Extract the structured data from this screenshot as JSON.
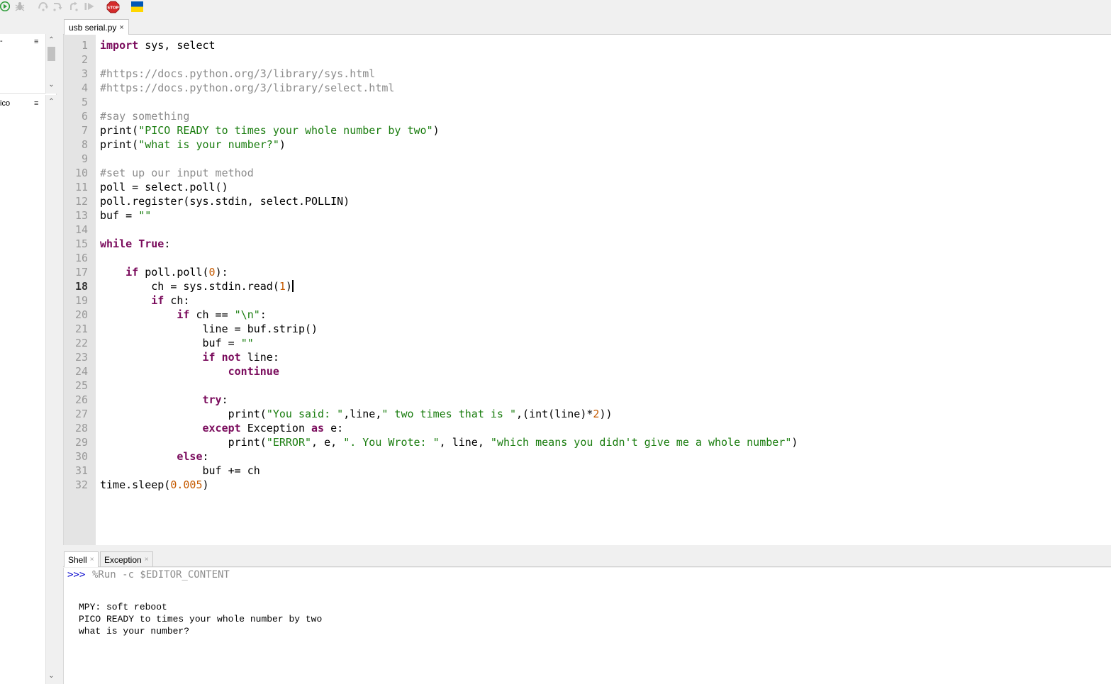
{
  "toolbar": {
    "stop_label": "STOP",
    "icons": [
      "run-icon",
      "debug-icon",
      "step-over-icon",
      "step-into-icon",
      "step-out-icon",
      "resume-icon",
      "stop-icon",
      "ukraine-flag-icon"
    ],
    "colors": {
      "run": "#2e9c3a",
      "stop": "#d42a2a",
      "flag_blue": "#0057b7",
      "flag_yellow": "#ffd700"
    }
  },
  "left_pane": {
    "top_label": "-",
    "bottom_label": "ico",
    "menu_glyph": "≡"
  },
  "editor": {
    "tab": {
      "title": "usb serial.py",
      "close": "×"
    },
    "current_line": 18,
    "line_numbers": [
      "1",
      "2",
      "3",
      "4",
      "5",
      "6",
      "7",
      "8",
      "9",
      "10",
      "11",
      "12",
      "13",
      "14",
      "15",
      "16",
      "17",
      "18",
      "19",
      "20",
      "21",
      "22",
      "23",
      "24",
      "25",
      "26",
      "27",
      "28",
      "29",
      "30",
      "31",
      "32"
    ],
    "lines": [
      [
        {
          "t": "import",
          "c": "kw"
        },
        {
          "t": " sys, select"
        }
      ],
      [],
      [
        {
          "t": "#https://docs.python.org/3/library/sys.html",
          "c": "cm"
        }
      ],
      [
        {
          "t": "#https://docs.python.org/3/library/select.html",
          "c": "cm"
        }
      ],
      [],
      [
        {
          "t": "#say something",
          "c": "cm"
        }
      ],
      [
        {
          "t": "print("
        },
        {
          "t": "\"PICO READY to times your whole number by two\"",
          "c": "str"
        },
        {
          "t": ")"
        }
      ],
      [
        {
          "t": "print("
        },
        {
          "t": "\"what is your number?\"",
          "c": "str"
        },
        {
          "t": ")"
        }
      ],
      [],
      [
        {
          "t": "#set up our input method",
          "c": "cm"
        }
      ],
      [
        {
          "t": "poll = select.poll()"
        }
      ],
      [
        {
          "t": "poll.register(sys.stdin, select.POLLIN)"
        }
      ],
      [
        {
          "t": "buf = "
        },
        {
          "t": "\"\"",
          "c": "str"
        }
      ],
      [],
      [
        {
          "t": "while",
          "c": "kw"
        },
        {
          "t": " "
        },
        {
          "t": "True",
          "c": "kw"
        },
        {
          "t": ":"
        }
      ],
      [],
      [
        {
          "t": "    "
        },
        {
          "t": "if",
          "c": "kw"
        },
        {
          "t": " poll.poll("
        },
        {
          "t": "0",
          "c": "num"
        },
        {
          "t": "):"
        }
      ],
      [
        {
          "t": "        ch = sys.stdin.read("
        },
        {
          "t": "1",
          "c": "num"
        },
        {
          "t": ")"
        }
      ],
      [
        {
          "t": "        "
        },
        {
          "t": "if",
          "c": "kw"
        },
        {
          "t": " ch:"
        }
      ],
      [
        {
          "t": "            "
        },
        {
          "t": "if",
          "c": "kw"
        },
        {
          "t": " ch == "
        },
        {
          "t": "\"\\n\"",
          "c": "str"
        },
        {
          "t": ":"
        }
      ],
      [
        {
          "t": "                line = buf.strip()"
        }
      ],
      [
        {
          "t": "                buf = "
        },
        {
          "t": "\"\"",
          "c": "str"
        }
      ],
      [
        {
          "t": "                "
        },
        {
          "t": "if",
          "c": "kw"
        },
        {
          "t": " "
        },
        {
          "t": "not",
          "c": "kw"
        },
        {
          "t": " line:"
        }
      ],
      [
        {
          "t": "                    "
        },
        {
          "t": "continue",
          "c": "kw"
        }
      ],
      [],
      [
        {
          "t": "                "
        },
        {
          "t": "try",
          "c": "kw"
        },
        {
          "t": ":"
        }
      ],
      [
        {
          "t": "                    print("
        },
        {
          "t": "\"You said: \"",
          "c": "str"
        },
        {
          "t": ",line,"
        },
        {
          "t": "\" two times that is \"",
          "c": "str"
        },
        {
          "t": ",(int(line)*"
        },
        {
          "t": "2",
          "c": "num"
        },
        {
          "t": "))"
        }
      ],
      [
        {
          "t": "                "
        },
        {
          "t": "except",
          "c": "kw"
        },
        {
          "t": " Exception "
        },
        {
          "t": "as",
          "c": "kw"
        },
        {
          "t": " e:"
        }
      ],
      [
        {
          "t": "                    print("
        },
        {
          "t": "\"ERROR\"",
          "c": "str"
        },
        {
          "t": ", e, "
        },
        {
          "t": "\". You Wrote: \"",
          "c": "str"
        },
        {
          "t": ", line, "
        },
        {
          "t": "\"which means you didn't give me a whole number\"",
          "c": "str"
        },
        {
          "t": ")"
        }
      ],
      [
        {
          "t": "            "
        },
        {
          "t": "else",
          "c": "kw"
        },
        {
          "t": ":"
        }
      ],
      [
        {
          "t": "                buf += ch"
        }
      ],
      [
        {
          "t": "time.sleep("
        },
        {
          "t": "0.005",
          "c": "num"
        },
        {
          "t": ")"
        }
      ]
    ]
  },
  "bottom": {
    "tabs": [
      {
        "label": "Shell",
        "close": "×"
      },
      {
        "label": "Exception",
        "close": "×"
      }
    ],
    "shell": {
      "prompt": ">>>",
      "command": "%Run -c $EDITOR_CONTENT",
      "output": [
        "MPY: soft reboot",
        "PICO READY to times your whole number by two",
        "what is your number?"
      ]
    }
  }
}
